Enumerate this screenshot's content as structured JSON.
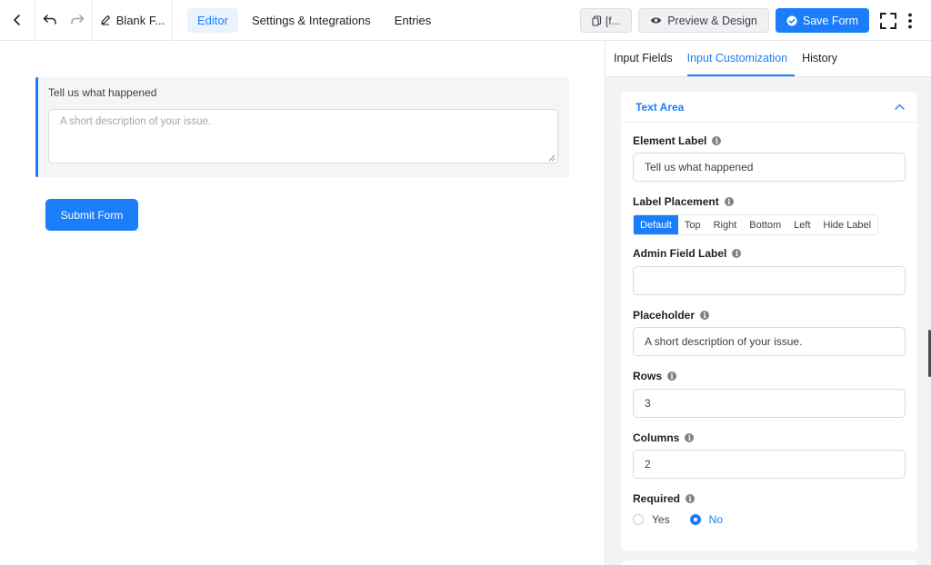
{
  "topbar": {
    "form_title": "Blank F...",
    "nav": [
      "Editor",
      "Settings & Integrations",
      "Entries"
    ],
    "shortcode_label": "[f...",
    "preview_label": "Preview & Design",
    "save_label": "Save Form"
  },
  "canvas": {
    "field_label": "Tell us what happened",
    "field_placeholder": "A short description of your issue.",
    "submit_label": "Submit Form"
  },
  "panel": {
    "tabs": [
      "Input Fields",
      "Input Customization",
      "History"
    ],
    "section_title": "Text Area",
    "element_label": {
      "label": "Element Label",
      "value": "Tell us what happened"
    },
    "label_placement": {
      "label": "Label Placement",
      "options": [
        "Default",
        "Top",
        "Right",
        "Bottom",
        "Left",
        "Hide Label"
      ],
      "selected": "Default"
    },
    "admin_label": {
      "label": "Admin Field Label",
      "value": ""
    },
    "placeholder": {
      "label": "Placeholder",
      "value": "A short description of your issue."
    },
    "rows": {
      "label": "Rows",
      "value": "3"
    },
    "columns": {
      "label": "Columns",
      "value": "2"
    },
    "required": {
      "label": "Required",
      "options": [
        "Yes",
        "No"
      ],
      "selected": "No"
    }
  },
  "colors": {
    "accent": "#1a7efb",
    "panel_bg": "#f2f3f5",
    "field_bg": "#f5f5f6"
  }
}
